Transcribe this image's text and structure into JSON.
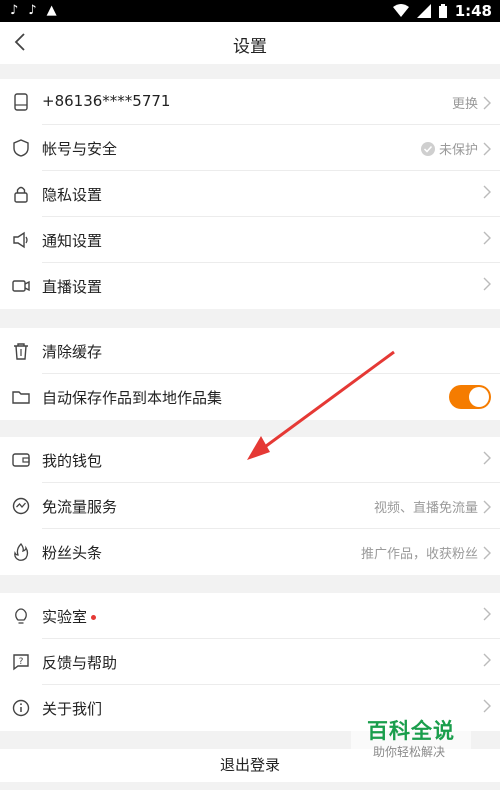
{
  "status_bar": {
    "time": "1:48"
  },
  "nav": {
    "title": "设置"
  },
  "account_group": [
    {
      "icon": "phone-icon",
      "label": "+86136****5771",
      "right_text": "更换"
    },
    {
      "icon": "shield-icon",
      "label": "帐号与安全",
      "right_text": "未保护",
      "right_icon": "check-circle-icon"
    },
    {
      "icon": "lock-icon",
      "label": "隐私设置",
      "right_text": ""
    },
    {
      "icon": "speaker-icon",
      "label": "通知设置",
      "right_text": ""
    },
    {
      "icon": "video-camera-icon",
      "label": "直播设置",
      "right_text": ""
    }
  ],
  "storage_group": [
    {
      "icon": "trash-icon",
      "label": "清除缓存"
    },
    {
      "icon": "folder-icon",
      "label": "自动保存作品到本地作品集",
      "toggle_on": true
    }
  ],
  "wallet_group": [
    {
      "icon": "wallet-icon",
      "label": "我的钱包",
      "right_text": ""
    },
    {
      "icon": "data-flow-icon",
      "label": "免流量服务",
      "right_text": "视频、直播免流量"
    },
    {
      "icon": "fire-icon",
      "label": "粉丝头条",
      "right_text": "推广作品，收获粉丝"
    }
  ],
  "misc_group": [
    {
      "icon": "lightbulb-icon",
      "label": "实验室",
      "red_dot": true
    },
    {
      "icon": "feedback-icon",
      "label": "反馈与帮助"
    },
    {
      "icon": "info-icon",
      "label": "关于我们"
    }
  ],
  "logout": {
    "label": "退出登录"
  },
  "watermark": {
    "title": "百科全说",
    "subtitle": "助你轻松解决"
  },
  "colors": {
    "toggle": "#f57c00",
    "arrow": "#e53935",
    "watermark_green": "#1a9e4c"
  }
}
